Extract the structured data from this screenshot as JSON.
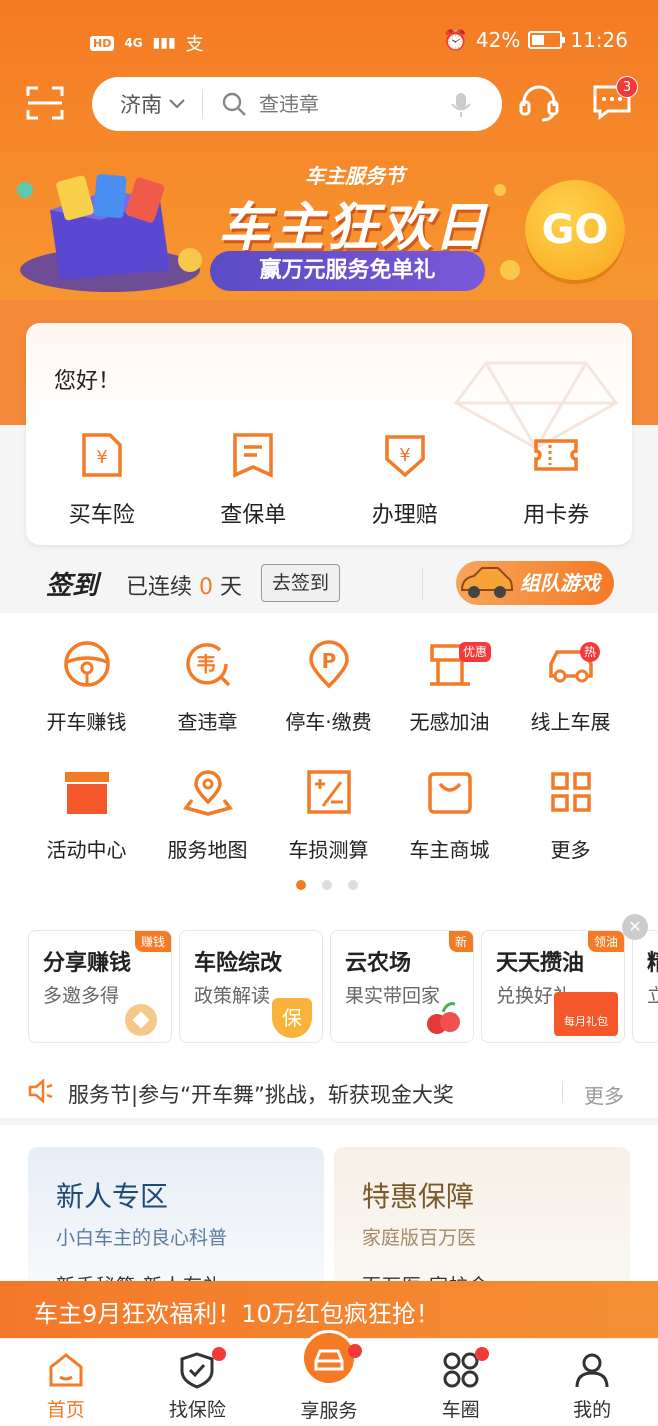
{
  "status_bar": {
    "hd": "HD",
    "signal": "4G",
    "pay": "支",
    "battery": "42%",
    "time": "11:26"
  },
  "header": {
    "city": "济南",
    "search_placeholder": "查违章",
    "message_count": "3"
  },
  "banner": {
    "tag": "车主服务节",
    "title": "车主狂欢日",
    "subtitle": "赢万元服务免单礼",
    "go": "GO"
  },
  "greeting": "您好！",
  "insurance": [
    {
      "label": "买车险"
    },
    {
      "label": "查保单"
    },
    {
      "label": "办理赔"
    },
    {
      "label": "用卡券"
    }
  ],
  "signin": {
    "title": "签到",
    "prefix": "已连续",
    "days": "0",
    "suffix": "天",
    "button": "去签到",
    "team": "组队游戏"
  },
  "services": [
    {
      "label": "开车赚钱"
    },
    {
      "label": "查违章"
    },
    {
      "label": "停车·缴费"
    },
    {
      "label": "无感加油",
      "badge": "优惠"
    },
    {
      "label": "线上车展",
      "badge": "热"
    },
    {
      "label": "活动中心"
    },
    {
      "label": "服务地图"
    },
    {
      "label": "车损测算"
    },
    {
      "label": "车主商城"
    },
    {
      "label": "更多"
    }
  ],
  "promos": [
    {
      "title": "分享赚钱",
      "sub": "多邀多得",
      "tag": "赚钱"
    },
    {
      "title": "车险综改",
      "sub": "政策解读",
      "tag": ""
    },
    {
      "title": "云农场",
      "sub": "果实带回家",
      "tag": "新"
    },
    {
      "title": "天天攒油",
      "sub": "兑换好礼",
      "tag": "领油"
    },
    {
      "title": "精",
      "sub": "立",
      "tag": ""
    }
  ],
  "promo_deco": {
    "badge_text": "保",
    "gift_text": "每月礼包"
  },
  "notice": {
    "text": "服务节|参与“开车舞”挑战，斩获现金大奖",
    "more": "更多"
  },
  "zones": [
    {
      "title": "新人专区",
      "sub": "小白车主的良心科普",
      "row": "新手秘籍    新人有礼"
    },
    {
      "title": "特惠保障",
      "sub": "家庭版百万医",
      "row": "百万医      家护金"
    }
  ],
  "strip": "车主9月狂欢福利！10万红包疯狂抢！",
  "tabs": [
    {
      "label": "首页"
    },
    {
      "label": "找保险"
    },
    {
      "label": "享服务"
    },
    {
      "label": "车圈"
    },
    {
      "label": "我的"
    }
  ],
  "colors": {
    "accent": "#f47a25",
    "badge": "#f23a3a"
  }
}
